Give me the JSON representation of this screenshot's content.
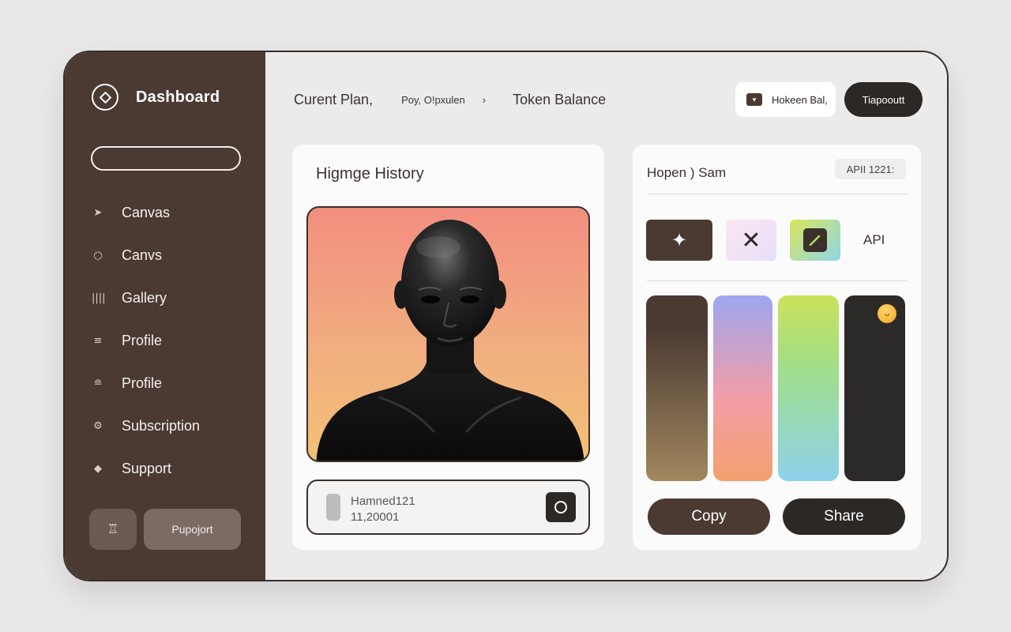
{
  "sidebar": {
    "title": "Dashboard",
    "search_placeholder": "",
    "items": [
      {
        "label": "Canvas",
        "icon": "send-icon"
      },
      {
        "label": "Canvs",
        "icon": "circle-icon"
      },
      {
        "label": "Gallery",
        "icon": "bars-icon"
      },
      {
        "label": "Profile",
        "icon": "list-icon"
      },
      {
        "label": "Profile",
        "icon": "stack-icon"
      },
      {
        "label": "Subscription",
        "icon": "gear-icon"
      },
      {
        "label": "Support",
        "icon": "diamond-icon"
      }
    ],
    "lock_glyph": "♖",
    "support_label": "Pupojort"
  },
  "header": {
    "plan_label": "Curent Plan,",
    "plan_value": "Poy, O!pxulen",
    "separator": "›",
    "token_label": "Token Balance",
    "balance_pill_label": "Hokeen Bal,",
    "topup_label": "Tiapooutt"
  },
  "history": {
    "title": "Higmge History",
    "file": {
      "name": "Hamned121",
      "size": "11,20001"
    }
  },
  "tools": {
    "title": "Hopen ) Sam",
    "api_badge": "APII 1221:",
    "api_label": "API",
    "copy_label": "Copy",
    "share_label": "Share"
  },
  "colors": {
    "sidebar_bg": "#4b3a32",
    "accent_dark": "#2b2826",
    "portrait_gradient": [
      "#f28e80",
      "#f2c177"
    ]
  }
}
